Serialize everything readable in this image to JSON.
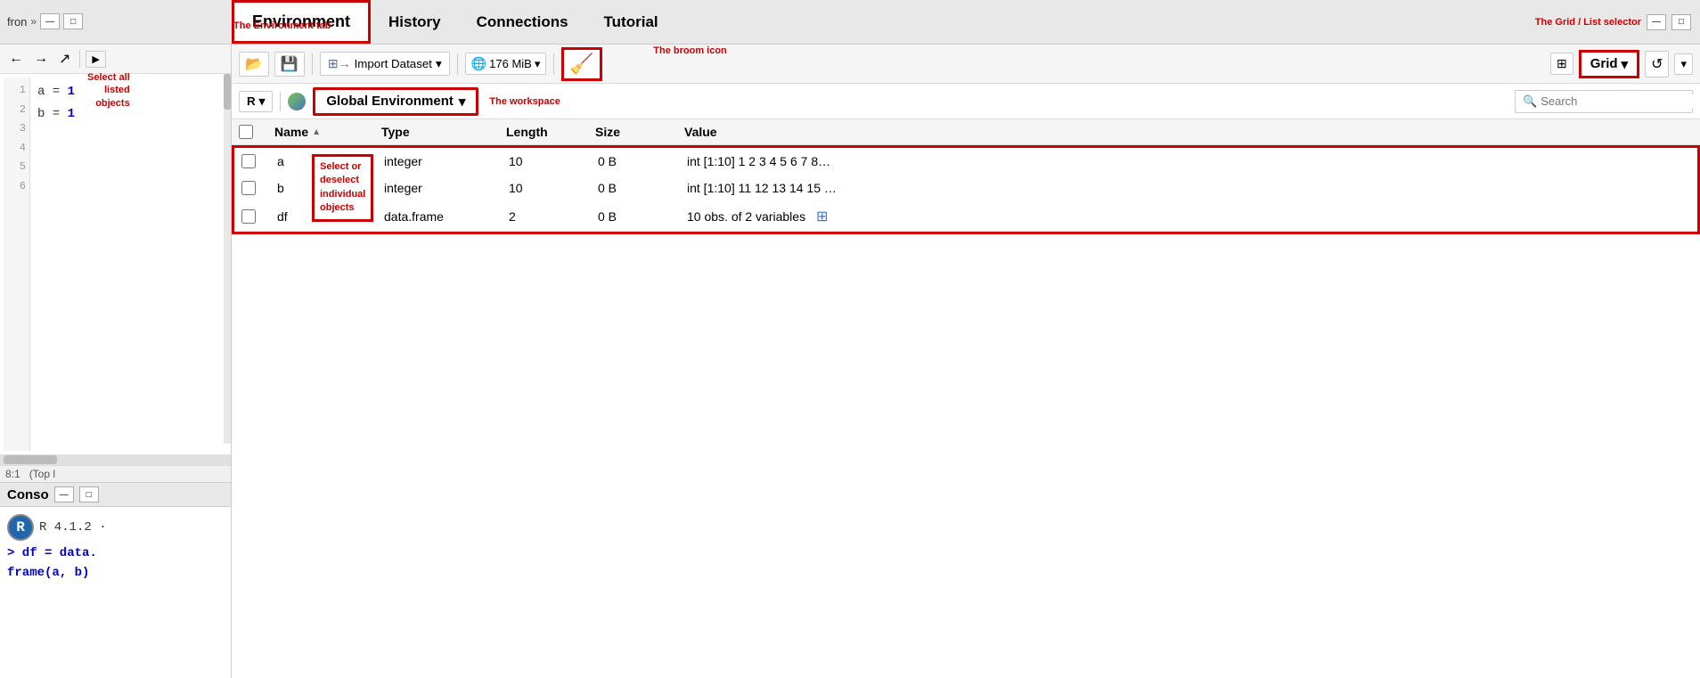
{
  "tabs": {
    "environment": "Environment",
    "history": "History",
    "connections": "Connections",
    "tutorial": "Tutorial"
  },
  "editor": {
    "lines": [
      {
        "num": "1",
        "code": ""
      },
      {
        "num": "2",
        "code": ""
      },
      {
        "num": "3",
        "code": "a = 1"
      },
      {
        "num": "4",
        "code": ""
      },
      {
        "num": "5",
        "code": "b = 1"
      },
      {
        "num": "6",
        "code": ""
      }
    ],
    "position": "8:1",
    "scroll": "Top l"
  },
  "console": {
    "title": "Conso",
    "version": "R 4.1.2 ·",
    "prompt1": "> df = data.",
    "prompt2": "frame(a, b)"
  },
  "toolbar": {
    "import_label": "Import Dataset",
    "memory": "176 MiB",
    "broom_icon": "🧹",
    "grid_label": "Grid",
    "annotation_grid": "The Grid / List selector",
    "annotation_broom": "The broom icon",
    "annotation_env_tab": "The Environment tab"
  },
  "workspace": {
    "r_label": "R",
    "global_env": "Global Environment",
    "annotation": "The workspace",
    "search_placeholder": "Search"
  },
  "table": {
    "columns": [
      "Name",
      "Type",
      "Length",
      "Size",
      "Value"
    ],
    "select_all_annotation": "Select all listed objects",
    "row_annotation": "Select or deselect individual objects",
    "rows": [
      {
        "name": "a",
        "type": "integer",
        "length": "10",
        "size": "0 B",
        "value": "int [1:10] 1 2 3 4 5 6 7 8…"
      },
      {
        "name": "b",
        "type": "integer",
        "length": "10",
        "size": "0 B",
        "value": "int [1:10] 11 12 13 14 15 …"
      },
      {
        "name": "df",
        "type": "data.frame",
        "length": "2",
        "size": "0 B",
        "value": "10 obs. of 2 variables"
      }
    ]
  },
  "icons": {
    "back": "←",
    "forward": "→",
    "source": "↗",
    "minimize": "—",
    "maximize": "□",
    "open_folder": "📂",
    "save": "💾",
    "import_arrow": "→",
    "globe": "🌐",
    "sort_asc": "▲",
    "chevron_down": "▾",
    "search": "🔍",
    "grid": "⊞",
    "refresh": "↺",
    "r_logo": "R"
  }
}
